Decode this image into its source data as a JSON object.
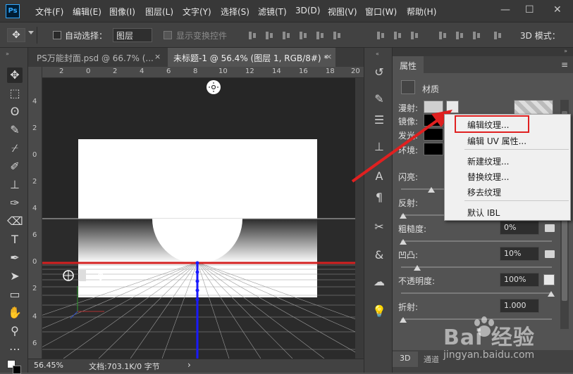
{
  "menubar": {
    "logo": "Ps",
    "items": [
      "文件(F)",
      "编辑(E)",
      "图像(I)",
      "图层(L)",
      "文字(Y)",
      "选择(S)",
      "滤镜(T)",
      "3D(D)",
      "视图(V)",
      "窗口(W)",
      "帮助(H)"
    ],
    "window_controls": [
      "—",
      "☐",
      "✕"
    ]
  },
  "options": {
    "auto_select_label": "自动选择：",
    "auto_select_value": "图层",
    "show_transform_label": "显示变换控件",
    "mode_3d_label": "3D 模式："
  },
  "tabs": [
    {
      "label": "PS万能封面.psd @ 66.7% (...",
      "close": "×"
    },
    {
      "label": "未标题-1 @ 56.4% (图层 1, RGB/8#) *",
      "close": "×"
    }
  ],
  "ruler": {
    "top": [
      "2",
      "0",
      "2",
      "4",
      "6",
      "8",
      "10",
      "12",
      "14",
      "16",
      "18",
      "20"
    ],
    "left": [
      "4",
      "2",
      "0",
      "2",
      "4",
      "6",
      "8",
      "10",
      "12",
      "14",
      "16",
      "0",
      "2"
    ]
  },
  "status": {
    "zoom": "56.45%",
    "doc": "文档:703.1K/0 字节",
    "arrow": "›"
  },
  "panel": {
    "tab": "属性",
    "section": "材质",
    "rows": [
      {
        "label": "漫射:"
      },
      {
        "label": "镜像:"
      },
      {
        "label": "发光:"
      },
      {
        "label": "环境:"
      }
    ],
    "shine_label": "闪亮:",
    "reflect_label": "反射:",
    "rough_label": "粗糙度:",
    "rough_value": "0%",
    "bump_label": "凹凸:",
    "bump_value": "10%",
    "opacity_label": "不透明度:",
    "opacity_value": "100%",
    "refract_label": "折射:",
    "refract_value": "1.000",
    "bottom_tabs": [
      "3D",
      "通道"
    ]
  },
  "context_menu": {
    "items": [
      "编辑纹理...",
      "编辑 UV 属性...",
      "新建纹理...",
      "替换纹理...",
      "移去纹理",
      "默认 IBL"
    ],
    "highlighted": "编辑纹理..."
  },
  "watermark": {
    "brand": "Bai 经验",
    "url": "jingyan.baidu.com"
  },
  "colors": {
    "accent_red": "#e02020",
    "ps_blue": "#31a8ff",
    "axis_blue": "#1a1aff"
  }
}
